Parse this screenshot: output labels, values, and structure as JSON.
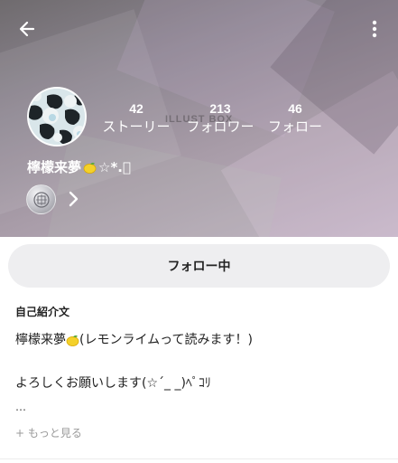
{
  "header": {
    "watermark": "ILLUST BOX"
  },
  "profile": {
    "username": "檸檬来夢",
    "username_suffix": "☆*.ﾟ",
    "stats": [
      {
        "value": "42",
        "label": "ストーリー"
      },
      {
        "value": "213",
        "label": "フォロワー"
      },
      {
        "value": "46",
        "label": "フォロー"
      }
    ]
  },
  "actions": {
    "follow_label": "フォロー中"
  },
  "bio": {
    "title": "自己紹介文",
    "line1_prefix": "檸檬来夢",
    "line1_suffix": "(レモンライムって読みます！)",
    "line2": "よろしくお願いします(☆´_ _)ﾍﾟｺﾘ",
    "line3": "…",
    "more_label": "+ もっと見る"
  },
  "icons": [
    "back-arrow-icon",
    "more-vert-icon",
    "lemon-icon",
    "badge-medal-icon",
    "chevron-right-icon"
  ],
  "colors": {
    "header": "#8c8590",
    "button_bg": "#eeeef0",
    "muted_text": "#9a9a9a"
  }
}
